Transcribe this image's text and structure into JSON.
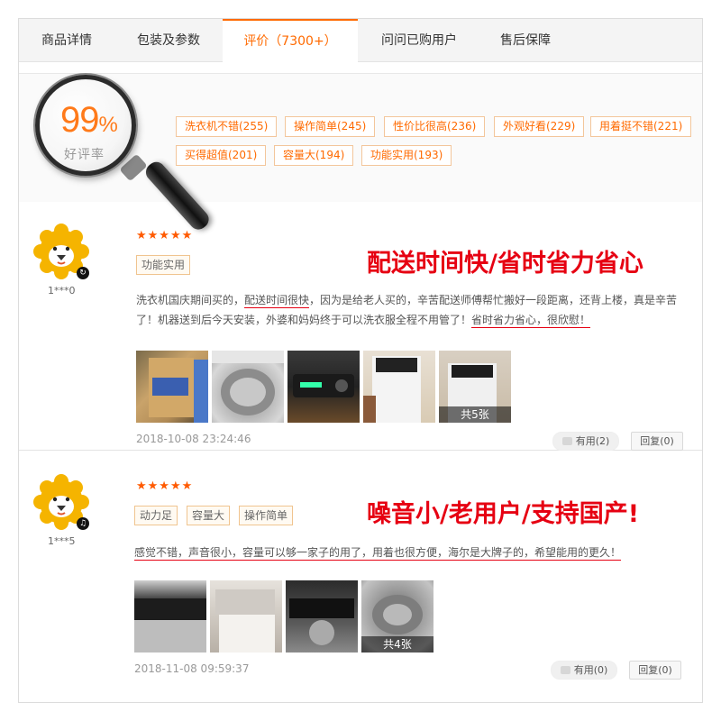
{
  "tabs": [
    {
      "label": "商品详情"
    },
    {
      "label": "包装及参数"
    },
    {
      "label": "评价（7300+）"
    },
    {
      "label": "问问已购用户"
    },
    {
      "label": "售后保障"
    }
  ],
  "summary": {
    "percent": "99",
    "percent_sign": "%",
    "label": "好评率",
    "tags": [
      "洗衣机不错(255)",
      "操作简单(245)",
      "性价比很高(236)",
      "外观好看(229)",
      "用着挺不错(221)",
      "买得超值(201)",
      "容量大(194)",
      "功能实用(193)"
    ]
  },
  "reviews": [
    {
      "user": "1***0",
      "badge": "↻",
      "stars": "★★★★★",
      "tags": [
        "功能实用"
      ],
      "headline": "配送时间快/省时省力省心",
      "line1_a": "洗衣机国庆期间买的，",
      "line1_hl": "配送时间很快",
      "line1_b": "，因为是给老人买的，辛苦配送师傅帮忙搬好一段距离，还背上楼，真是辛苦",
      "line2_a": "了！机器送到后今天安装，外婆和妈妈终于可以洗衣服全程不用管了！",
      "line2_hl": "省时省力省心，很欣慰！",
      "photo_count": "共5张",
      "date": "2018-10-08 23:24:46",
      "useful": "有用(2)",
      "reply": "回复(0)"
    },
    {
      "user": "1***5",
      "badge": "♫",
      "stars": "★★★★★",
      "tags": [
        "动力足",
        "容量大",
        "操作简单"
      ],
      "headline": "噪音小/老用户/支持国产!",
      "line1_hl": "感觉不错，声音很小，容量可以够一家子的用了，用着也很方便，海尔是大牌子的，希望能用的更久！",
      "photo_count": "共4张",
      "date": "2018-11-08 09:59:37",
      "useful": "有用(0)",
      "reply": "回复(0)"
    }
  ],
  "colors": {
    "accent": "#ff6a00",
    "headline": "#e60012",
    "star": "#ff5a00"
  }
}
